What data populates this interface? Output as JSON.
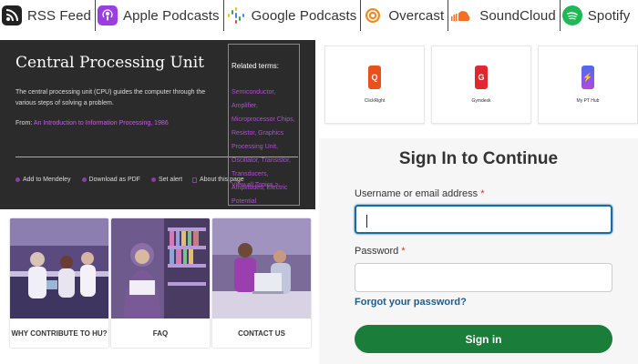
{
  "podcasts": [
    {
      "label": "RSS Feed",
      "icon": "rss-icon",
      "color": "#222222"
    },
    {
      "label": "Apple Podcasts",
      "icon": "apple-podcasts-icon",
      "color": "#9b3ee0"
    },
    {
      "label": "Google Podcasts",
      "icon": "google-podcasts-icon",
      "color": "#4285f4"
    },
    {
      "label": "Overcast",
      "icon": "overcast-icon",
      "color": "#f08a24"
    },
    {
      "label": "SoundCloud",
      "icon": "soundcloud-icon",
      "color": "#f26f23"
    },
    {
      "label": "Spotify",
      "icon": "spotify-icon",
      "color": "#1db954"
    }
  ],
  "cpu": {
    "title": "Central Processing Unit",
    "description": "The central processing unit (CPU) guides the computer through the various steps of solving a problem.",
    "from_label": "From:",
    "from_link": "An Introduction to Information Processing, 1986",
    "actions": [
      "Add to Mendeley",
      "Download as PDF",
      "Set alert"
    ],
    "about": "About this page",
    "related_title": "Related terms:",
    "related_terms": "Semiconductor, Amplifier, Microprocessor Chips, Resistor, Graphics Processing Unit, Oscillator, Transistor, Transducers, Amplitudes, Electric Potential",
    "view_all": "View all Topics  >"
  },
  "cards": [
    {
      "caption": "WHY CONTRIBUTE TO HU?"
    },
    {
      "caption": "FAQ"
    },
    {
      "caption": "CONTACT US"
    }
  ],
  "apps": [
    {
      "name": "ClickRight",
      "icon": "clickright-icon",
      "color": "#e8501e",
      "glyph": "Q"
    },
    {
      "name": "Gymdesk",
      "icon": "gymdesk-icon",
      "color": "#e0262e",
      "glyph": "G"
    },
    {
      "name": "My PT Hub",
      "icon": "mypthub-icon",
      "color": "#3f63f0",
      "glyph": "⚡"
    }
  ],
  "signin": {
    "title": "Sign In to Continue",
    "username_label": "Username or email address",
    "password_label": "Password",
    "required_mark": "*",
    "forgot": "Forgot your password?",
    "button": "Sign in"
  },
  "colors": {
    "accent_green": "#1b7d3a",
    "focus_blue": "#1a6aa0",
    "link_blue": "#1f5b8c",
    "purple_link": "#b04fd0"
  }
}
